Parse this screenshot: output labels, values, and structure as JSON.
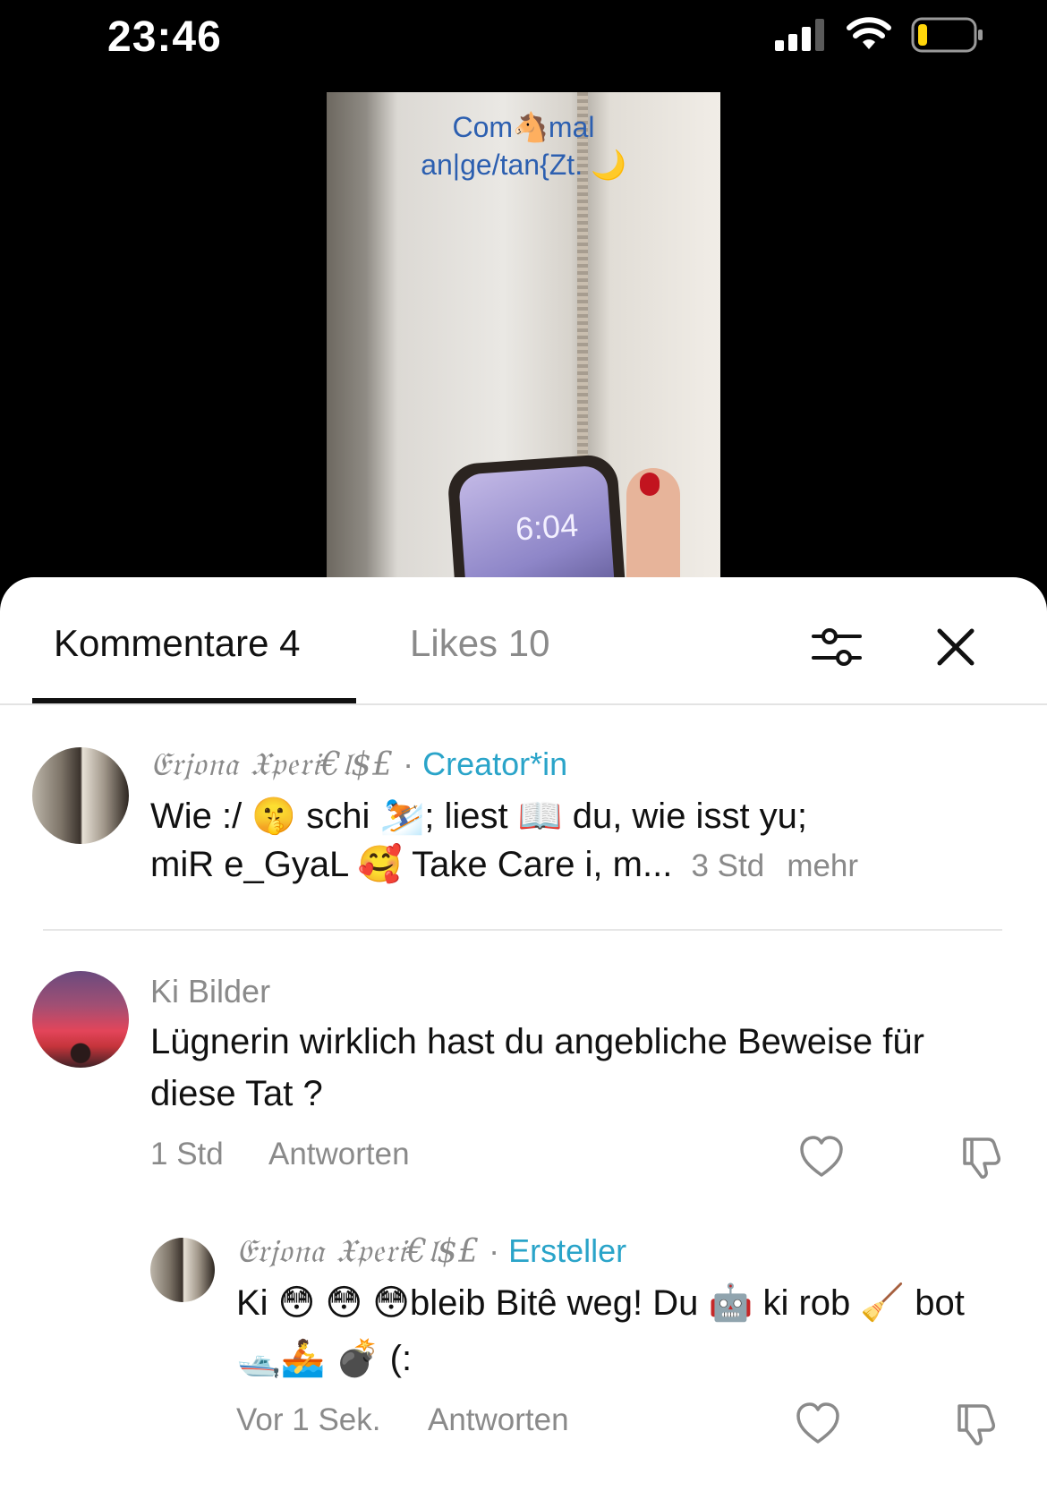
{
  "status_bar": {
    "time": "23:46"
  },
  "video": {
    "caption_line1": "Com🐴mal",
    "caption_line2": "an|ge/tan{Zt. 🌙",
    "lockscreen_time": "6:04"
  },
  "tabs": {
    "comments_label": "Kommentare 4",
    "likes_label": "Likes 10"
  },
  "comments": [
    {
      "author": "𝔈𝔯𝔧𝔬𝔫𝔞 𝔛𝔭𝔢𝔯𝔦€𝔩$£",
      "separator": " · ",
      "badge": "Creator*in",
      "text_line1": "Wie :/ 🤫 schi ⛷️; liest 📖 du, wie isst yu;",
      "text_line2": "miR e_GyaL 🥰 Take Care i, m...",
      "time": "3 Std",
      "more": "mehr"
    },
    {
      "author": "Ki Bilder",
      "text": "Lügnerin wirklich hast du angebliche Beweise für diese Tat ?",
      "time": "1 Std",
      "reply": "Antworten"
    },
    {
      "author": "𝔈𝔯𝔧𝔬𝔫𝔞 𝔛𝔭𝔢𝔯𝔦€𝔩$£",
      "separator": " · ",
      "badge": "Ersteller",
      "text": "Ki 😳 😳 😳bleib Bitê weg! Du 🤖 ki rob 🧹 bot 🛥️🚣 💣 (:",
      "time": "Vor 1 Sek.",
      "reply": "Antworten"
    }
  ],
  "colors": {
    "accent": "#2aa4c9",
    "muted": "#8a8a8a",
    "text": "#111111"
  },
  "icons": [
    "signal-icon",
    "wifi-icon",
    "battery-icon",
    "filter-icon",
    "close-icon",
    "heart-icon",
    "dislike-icon"
  ]
}
